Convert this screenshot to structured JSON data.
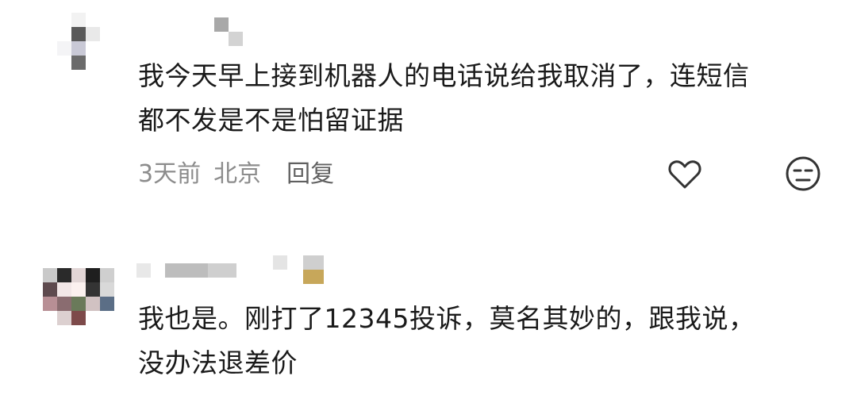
{
  "comments": [
    {
      "text": "我今天早上接到机器人的电话说给我取消了，连短信\n都不发是不是怕留证据",
      "time": "3天前",
      "location": "北京",
      "reply_label": "回复",
      "like_icon": "heart-outline-icon",
      "dislike_icon": "meh-face-icon"
    },
    {
      "text": "我也是。刚打了12345投诉，莫名其妙的，跟我说，\n没办法退差价"
    }
  ]
}
